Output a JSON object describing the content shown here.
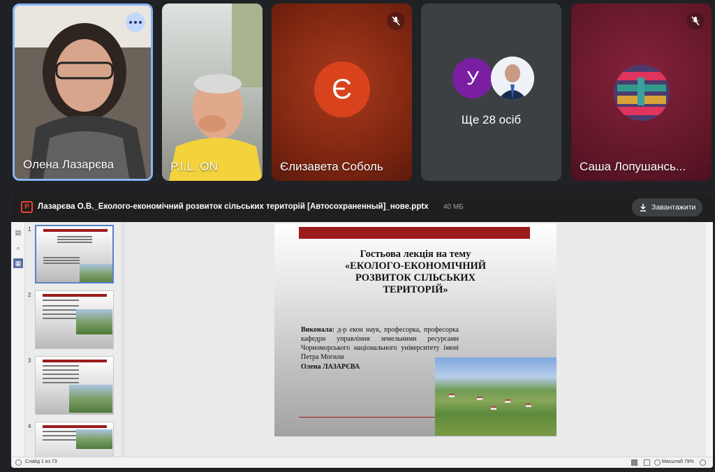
{
  "participants": [
    {
      "name": "Олена Лазарєва",
      "active_speaker": true,
      "menu_icon": "more-options-icon"
    },
    {
      "name": "P.I.L. ON"
    },
    {
      "name": "Єлизавета Соболь",
      "avatar_letter": "Є",
      "muted": true
    },
    {
      "more_label": "Ще 28 осіб",
      "avatar_letter": "У",
      "avatar_color": "#7b1fa2"
    },
    {
      "name": "Саша Лопушансь...",
      "muted": true
    }
  ],
  "presentation": {
    "file_name": "Лазарєва О.В._Еколого-економічний розвиток сільських територій [Автосохраненный]_нове.pptx",
    "file_size": "40 МБ",
    "download_label": "Завантажити",
    "thumbnail_numbers": [
      "1",
      "2",
      "3",
      "4"
    ],
    "slide": {
      "title": "Гостьова лекція на тему\n«ЕКОЛОГО-ЕКОНОМІЧНИЙ\nРОЗВИТОК СІЛЬСЬКИХ\nТЕРИТОРІЙ»",
      "body_label": "Виконала:",
      "body_text": " д-р екон наук, професорка, професорка кафедри управління земельними ресурсами Чорноморського національного університету імені Петра Могили",
      "author": "Олена ЛАЗАРЄВА"
    },
    "status": {
      "slide_counter": "Слайд 1 из 73",
      "zoom": "Масштаб 79%"
    },
    "accent_color": "#9b1c1c"
  }
}
